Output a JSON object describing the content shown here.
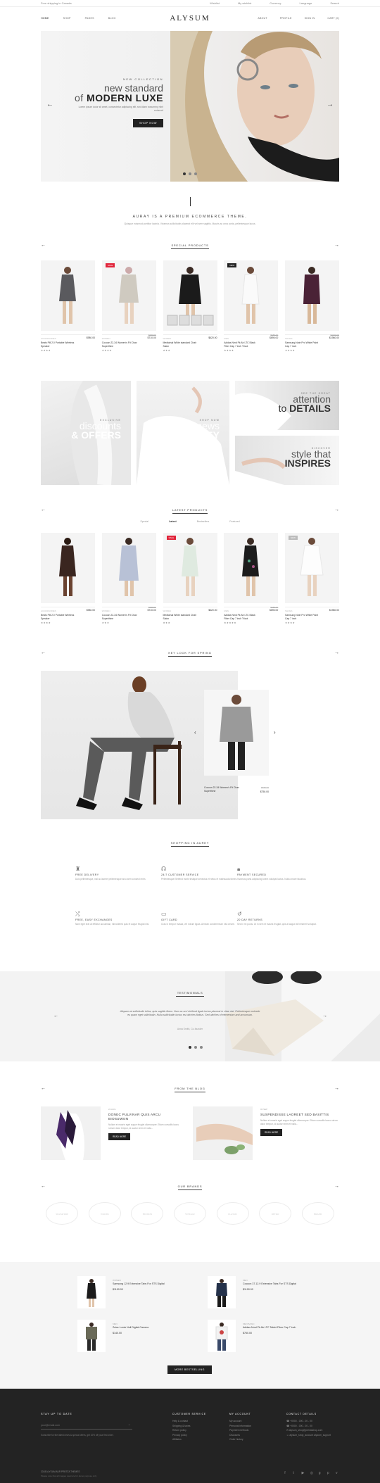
{
  "topbar": {
    "left": "Free shipping in Canada",
    "links": [
      "Wishlist",
      "My wishlist",
      "Currency",
      "Language",
      "Search"
    ]
  },
  "nav": {
    "left": [
      "HOME",
      "SHOP",
      "PAGES",
      "BLOG"
    ],
    "logo": "ALYSUM",
    "right": [
      "ABOUT",
      "PROFILE",
      "SIGN IN",
      "CART (0)"
    ]
  },
  "hero": {
    "kicker": "NEW COLLECTION",
    "line1": "new standard",
    "line2_pre": "of",
    "line2": "MODERN LUXE",
    "desc": "Lorem ipsum dolor sit amet, consectetur adipiscing elit, sed diam nonummy nibh euismod",
    "button": "SHOP NOW"
  },
  "intro": {
    "title": "AURAY IS A PREMIUM ECOMMERCE THEME.",
    "sub": "Quisque euismod porttitor lacinia. Vivamus sollicitudin placerat elit vel sem sagittis. Mauris ac urna porta, pellentesque lacus."
  },
  "special": {
    "title": "SPECIAL PRODUCTS",
    "products": [
      {
        "cat": "ACCESSORIES",
        "name": "Beats Pill 2.0 Portable Wireless Speaker",
        "price": "$980.00",
        "old": "",
        "badge": "",
        "stars": "★★★★"
      },
      {
        "cat": "WOMEN",
        "name": "Cocoon 22-34 Women's Fit Chav Superthine",
        "price": "$710.00",
        "old": "$680.00",
        "badge": "SALE",
        "stars": "★★★★"
      },
      {
        "cat": "WOMEN",
        "name": "Medtainal White standard Chair Salon",
        "price": "$620.00",
        "old": "",
        "badge": "",
        "stars": "★★★"
      },
      {
        "cat": "MEN",
        "name": "Adidas Nmd Pk Ab LTC Black Fiber Cap 7 inch Tricot",
        "price": "$695.00",
        "old": "$680.00",
        "badge": "NEW",
        "stars": "★★★★"
      },
      {
        "cat": "SHOES",
        "name": "Samsung Note Pro White Paint Cap 7 inch",
        "price": "$1980.00",
        "old": "$2100.00",
        "badge": "",
        "stars": "★★★★"
      }
    ]
  },
  "banners": {
    "b1": {
      "kicker": "EXCLUSIVE",
      "line1": "discounts",
      "line2": "& OFFERS"
    },
    "b2": {
      "kicker": "SHOP NOW",
      "line1": "hottest news",
      "line2": "#AUREY"
    },
    "b3": {
      "kicker": "SEE THE GREAT",
      "line1": "attention",
      "line2pre": "to",
      "line2": "DETAILS"
    },
    "b4": {
      "kicker": "DISCOVER",
      "line1": "style that",
      "line2": "INSPIRES"
    }
  },
  "latest": {
    "title": "LATEST PRODUCTS",
    "tabs": [
      "Special",
      "Latest",
      "Bestsellers",
      "Featured"
    ],
    "products": [
      {
        "cat": "ACCESSORIES",
        "name": "Beats Pill 2.0 Portable Wireless Speaker",
        "price": "$980.00",
        "old": "",
        "badge": "",
        "stars": "★★★★"
      },
      {
        "cat": "WOMEN",
        "name": "Cocoon 22-34 Women's Fit Chav Superthine",
        "price": "$710.00",
        "old": "$680.00",
        "badge": "",
        "stars": "★★★"
      },
      {
        "cat": "WOMEN",
        "name": "Medtainal White standard Chair Salon",
        "price": "$620.00",
        "old": "",
        "badge": "SALE",
        "stars": "★★★"
      },
      {
        "cat": "MEN",
        "name": "Adidas Nmd Pk Ab LTC Black Fiber Cap 7 inch Tricot",
        "price": "$695.00",
        "old": "$680.00",
        "badge": "",
        "stars": "★★★★★"
      },
      {
        "cat": "SHOES",
        "name": "Samsung Note Pro White Paint Cap 7 inch",
        "price": "$1980.00",
        "old": "",
        "badge": "NEW",
        "stars": "★★★★"
      }
    ]
  },
  "keylook": {
    "title": "KEY LOOK FOR SPRING",
    "product_name": "Cocoon 22-34 Women's Fit Chav Superthine",
    "product_old": "$680.00",
    "product_price": "$750.00"
  },
  "shopping": {
    "title": "SHOPPING IN AUREY",
    "features": [
      {
        "icon": "tower",
        "title": "FREE DELIVERY",
        "desc": "Duis pellentesque, nisl ac laoreet pellentesque arcu sem consect enim."
      },
      {
        "icon": "headset",
        "title": "24/7 CUSTOMER SERVICE",
        "desc": "Pellentesque Eleifend morbi tristique senectus et netus et malesuada fames."
      },
      {
        "icon": "lock",
        "title": "PAYMENT SECURED",
        "desc": "Vivamus porta adipiscing lorem volutpat luctus. Nulla ornare faucibus."
      },
      {
        "icon": "shuffle",
        "title": "FREE, EASY EXCHANGES",
        "desc": "Nam eget erat at efficitur accumsan, inbroidered quis et augue feugiat nisl."
      },
      {
        "icon": "gift",
        "title": "GIFT CARD",
        "desc": "Cras in tempor massa, vel rutrum ligula. Aenean condimentum nisl ornare."
      },
      {
        "icon": "return",
        "title": "20 DAY RETURNS",
        "desc": "Sed in mi purus. Ut in sem et mauris feugiat, quis at augue at hendrerit volutpat."
      }
    ]
  },
  "testimonials": {
    "title": "TESTIMONIALS",
    "quote": "Aliquam at sollicitudin tellus, quis sagittis libero. Nam ac orci eleifend ligula luctus placerat in vitae nisl. Pellentesque molestie eu quam eget sollicitudin. Nulla sollicitudin luctus est ultricies finibus. Sed ultricies of elementum and accumsan.",
    "author": "Anna Smith, Co-founder"
  },
  "blog": {
    "title": "FROM THE BLOG",
    "posts": [
      {
        "date": "22 AUG",
        "title": "DONEC PULVINAR QUIS ARCU BIOSUMSIN",
        "excerpt": "Nullam et mauris eget augue feugiat ullamcorper. Etiam convallis lacus rutrum dolor tempor, id auctor enim et nulla...",
        "button": "READ MORE"
      },
      {
        "date": "06 SEP",
        "title": "SUSPENDISSE LAOREET SED BASITTIS",
        "excerpt": "Nullam et mauris eget augue feugiat ullamcorper. Etiam convallis lacus rutrum dolor tempor, id auctor enim et nulla...",
        "button": "READ MORE"
      }
    ]
  },
  "brands": {
    "title": "OUR BRANDS",
    "items": [
      "SIGNATURE",
      "WOODS",
      "HUDSON",
      "VINTAGE",
      "CLASSIC",
      "RETRO",
      "BRAND"
    ]
  },
  "bestsellers": {
    "items": [
      {
        "cat": "WOMEN",
        "name": "Samsung 12.9 Extensive Tabs For STS Digital",
        "price": "$1190.00"
      },
      {
        "cat": "MEN",
        "name": "Cocoon 37.12.9 Extensive Tabs For STS Digital",
        "price": "$1190.00"
      },
      {
        "cat": "MEN",
        "name": "Zeiss Lumix Null Digital Camera",
        "price": "$140.00"
      },
      {
        "cat": "MEN BASIC",
        "name": "Adidas Nmd Pk Ab LTC Tablet Fiber Cap 7 inch",
        "price": "$760.00"
      }
    ],
    "button": "MORE BESTSELLING"
  },
  "footer": {
    "stay_title": "STAY UP TO DATE",
    "email_placeholder": "your@email.com",
    "stay_note": "Subscribe for the latest news & special offers, get 10% off your first order.",
    "customer_title": "CUSTOMER SERVICE",
    "customer_links": [
      "Help & contact",
      "Shipping & taxes",
      "Return policy",
      "Privacy policy",
      "Affiliates"
    ],
    "account_title": "MY ACCOUNT",
    "account_links": [
      "My account",
      "Personal information",
      "Payment methods",
      "Discounts",
      "Order history"
    ],
    "contact_title": "CONTACT DETAILS",
    "contact_lines": [
      "+0000 - 000 - 00 - 00",
      "+0000 - 000 - 00 - 00",
      "alysum_shop@prestashop.com",
      "alysum_shop_account alysum_support"
    ],
    "copyright": "2018 ALYSUM AUR PRESTA THEMES",
    "copyright_sub": "Please note that all images used are for demo purpose only"
  }
}
